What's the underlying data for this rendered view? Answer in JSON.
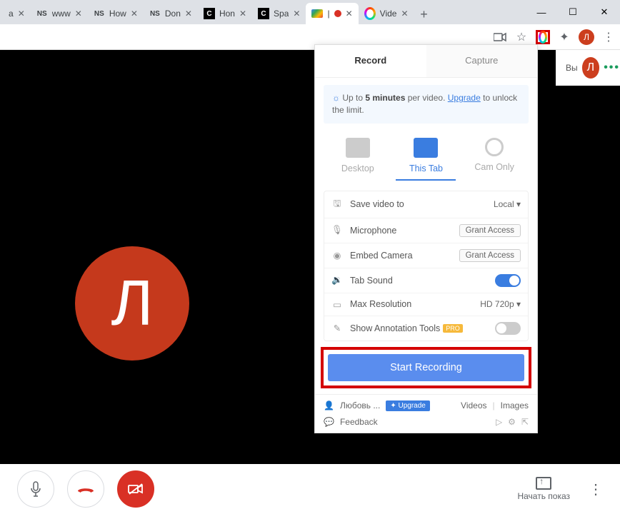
{
  "browser": {
    "tabs": [
      {
        "favicon": "",
        "title": "a",
        "active": false
      },
      {
        "favicon": "NS",
        "title": "www",
        "active": false
      },
      {
        "favicon": "NS",
        "title": "How",
        "active": false
      },
      {
        "favicon": "NS",
        "title": "Don",
        "active": false
      },
      {
        "favicon": "C",
        "title": "Hon",
        "active": false
      },
      {
        "favicon": "C",
        "title": "Spa",
        "active": false
      },
      {
        "favicon": "cam",
        "title": "● |",
        "active": true
      },
      {
        "favicon": "ring",
        "title": "Vide",
        "active": false
      }
    ],
    "profile_letter": "Л"
  },
  "meet": {
    "avatar_letter": "Л",
    "sidebar_text": "Вы",
    "present_label": "Начать показ"
  },
  "panel": {
    "tabs": {
      "record": "Record",
      "capture": "Capture"
    },
    "banner_prefix": "Up to ",
    "banner_bold": "5 minutes",
    "banner_mid": " per video. ",
    "banner_link": "Upgrade",
    "banner_suffix": " to unlock the limit.",
    "modes": {
      "desktop": "Desktop",
      "thistab": "This Tab",
      "camonly": "Cam Only"
    },
    "settings": {
      "save_label": "Save video to",
      "save_value": "Local",
      "mic_label": "Microphone",
      "mic_btn": "Grant Access",
      "cam_label": "Embed Camera",
      "cam_btn": "Grant Access",
      "sound_label": "Tab Sound",
      "res_label": "Max Resolution",
      "res_value": "HD 720p",
      "ann_label": "Show Annotation Tools",
      "pro": "PRO"
    },
    "start": "Start Recording",
    "footer": {
      "user": "Любовь ...",
      "upgrade": "✦ Upgrade",
      "videos": "Videos",
      "images": "Images",
      "feedback": "Feedback"
    }
  }
}
